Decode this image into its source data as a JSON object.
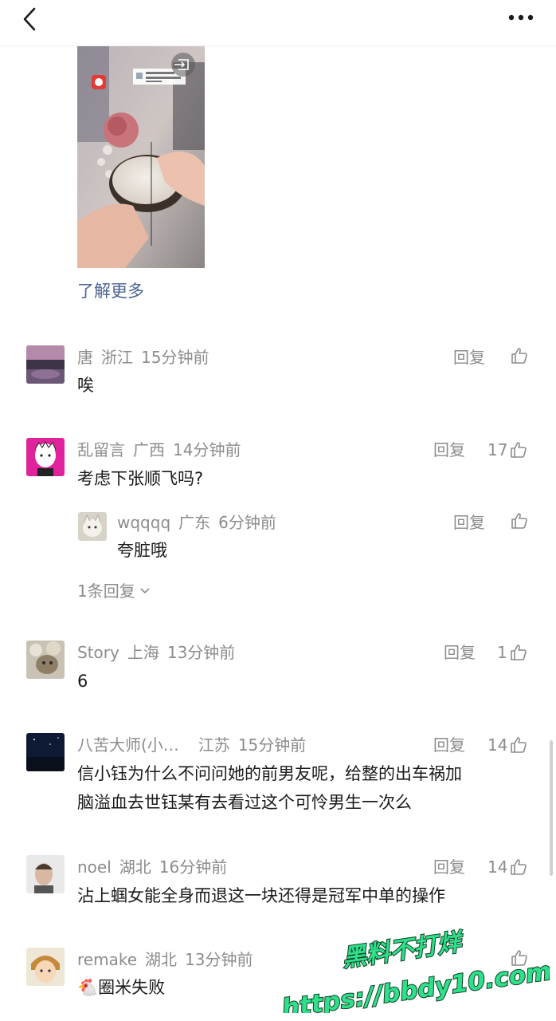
{
  "header": {
    "back_icon": "chevron-left-icon",
    "more_icon": "more-horizontal-icon"
  },
  "learn_more": "了解更多",
  "comments": [
    {
      "user": "唐",
      "location": "浙江",
      "time": "15分钟前",
      "text": "唉",
      "reply": "回复",
      "likes": ""
    },
    {
      "user": "乱留言",
      "location": "广西",
      "time": "14分钟前",
      "text": "考虑下张顺飞吗?",
      "reply": "回复",
      "likes": "17",
      "sub": {
        "user": "wqqqq",
        "location": "广东",
        "time": "6分钟前",
        "text": "夸脏哦",
        "reply": "回复",
        "likes": ""
      },
      "more_replies": "1条回复"
    },
    {
      "user": "Story",
      "location": "上海",
      "time": "13分钟前",
      "text": "6",
      "reply": "回复",
      "likes": "1"
    },
    {
      "user": "八苦大师(小…",
      "location": "江苏",
      "time": "15分钟前",
      "text_line1": "信小钰为什么不问问她的前男友呢，给整的出车祸加",
      "text_line2": "脑溢血去世钰某有去看过这个可怜男生一次么",
      "reply": "回复",
      "likes": "14"
    },
    {
      "user": "noel",
      "location": "湖北",
      "time": "16分钟前",
      "text": "沾上蝈女能全身而退这一块还得是冠军中单的操作",
      "reply": "回复",
      "likes": "14"
    },
    {
      "user": "remake",
      "location": "湖北",
      "time": "13分钟前",
      "text": "🐔圈米失败",
      "reply": "",
      "likes": ""
    }
  ],
  "watermark": {
    "line1": "黑料不打烊",
    "line2": "https://bbdy10.com"
  },
  "colors": {
    "link": "#4a6393",
    "meta": "#8c8c8c",
    "watermark_fill": "#2fe08a"
  }
}
